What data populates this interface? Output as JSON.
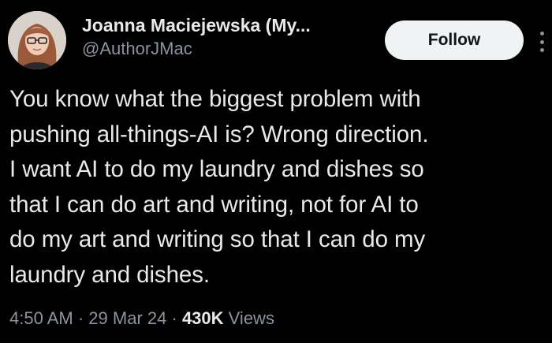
{
  "author": {
    "display_name": "Joanna Maciejewska (My...",
    "handle": "@AuthorJMac",
    "avatar_icon": "profile-photo"
  },
  "follow_label": "Follow",
  "more_icon": "more-vertical-icon",
  "tweet": {
    "text": "You know what the biggest problem with\npushing all-things-AI is? Wrong direction.\nI want AI to do my laundry and dishes so\nthat I can do art and writing, not for AI to\ndo my art and writing so that I can do my\nlaundry and dishes."
  },
  "meta": {
    "time": "4:50 AM",
    "separator": "·",
    "date": "29 Mar 24",
    "views_count": "430K",
    "views_label": "Views"
  },
  "colors": {
    "background": "#000000",
    "text_primary": "#e7e9ea",
    "text_secondary": "#8b949e",
    "follow_bg": "#eff3f4"
  }
}
